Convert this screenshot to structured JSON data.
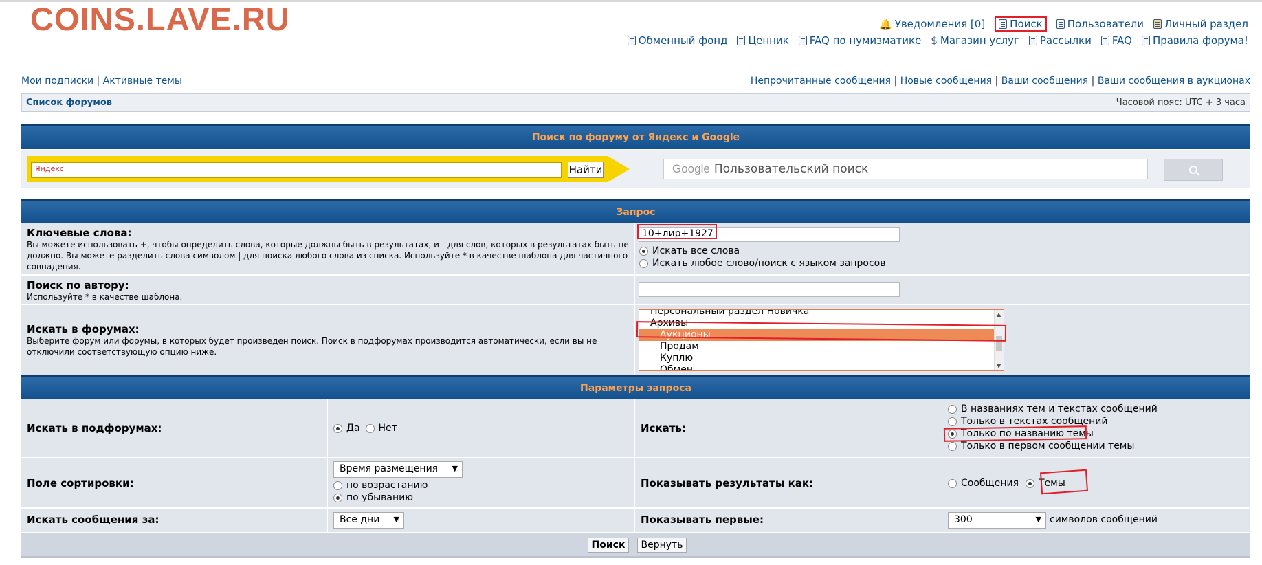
{
  "header": {
    "logo": "COINS.LAVE.RU",
    "nav_top": [
      {
        "label": "Уведомления [0]",
        "icon": "bell-icon"
      },
      {
        "label": "Поиск",
        "icon": "search-icon"
      },
      {
        "label": "Пользователи",
        "icon": "list-icon"
      },
      {
        "label": "Личный раздел",
        "icon": "user-icon"
      }
    ],
    "nav_bottom": [
      {
        "label": "Обменный фонд",
        "icon": "list-icon"
      },
      {
        "label": "Ценник",
        "icon": "list-icon"
      },
      {
        "label": "FAQ по нумизматике",
        "icon": "question-icon"
      },
      {
        "label": "Магазин услуг",
        "icon": "coins-icon"
      },
      {
        "label": "Рассылки",
        "icon": "newsletter-icon"
      },
      {
        "label": "FAQ",
        "icon": "question-icon"
      },
      {
        "label": "Правила форума!",
        "icon": "exclamation-icon"
      }
    ]
  },
  "subnav": {
    "left": [
      "Мои подписки",
      "Активные темы"
    ],
    "right": [
      "Непрочитанные сообщения",
      "Новые сообщения",
      "Ваши сообщения",
      "Ваши сообщения в аукционах"
    ]
  },
  "breadcrumb": {
    "label": "Список форумов",
    "timezone": "Часовой пояс: UTC + 3 часа"
  },
  "site_search": {
    "title": "Поиск по форуму от Яндекс и Google",
    "yandex_placeholder": "Яндекс",
    "yandex_button": "Найти",
    "google_placeholder": "Пользовательский поиск",
    "google_logo": "Google"
  },
  "query": {
    "title": "Запрос",
    "keywords_label": "Ключевые слова:",
    "keywords_hint": "Вы можете использовать +, чтобы определить слова, которые должны быть в результатах, и - для слов, которых в результатах быть не должно. Вы можете разделить слова символом | для поиска любого слова из списка. Используйте * в качестве шаблона для частичного совпадения.",
    "keywords_value": "10+лир+1927",
    "match_all": "Искать все слова",
    "match_any": "Искать любое слово/поиск с языком запросов",
    "author_label": "Поиск по автору:",
    "author_hint": "Используйте * в качестве шаблона.",
    "author_value": "",
    "forums_label": "Искать в форумах:",
    "forums_hint": "Выберите форум или форумы, в которых будет произведен поиск. Поиск в подфорумах производится автоматически, если вы не отключили соответствующую опцию ниже.",
    "forums_options": [
      {
        "label": "Персональный раздел Новичка",
        "sub": false,
        "selected": false
      },
      {
        "label": "Архивы",
        "sub": false,
        "selected": false
      },
      {
        "label": "Аукционы",
        "sub": true,
        "selected": true
      },
      {
        "label": "Продам",
        "sub": true,
        "selected": false
      },
      {
        "label": "Куплю",
        "sub": true,
        "selected": false
      },
      {
        "label": "Обмен",
        "sub": true,
        "selected": false
      }
    ]
  },
  "params": {
    "title": "Параметры запроса",
    "subforums_label": "Искать в подфорумах:",
    "subforums_yes": "Да",
    "subforums_no": "Нет",
    "search_in_label": "Искать:",
    "search_in_options": [
      "В названиях тем и текстах сообщений",
      "Только в текстах сообщений",
      "Только по названию темы",
      "Только в первом сообщении темы"
    ],
    "sort_label": "Поле сортировки:",
    "sort_value": "Время размещения",
    "sort_asc": "по возрастанию",
    "sort_desc": "по убыванию",
    "show_as_label": "Показывать результаты как:",
    "show_as_posts": "Сообщения",
    "show_as_topics": "Темы",
    "period_label": "Искать сообщения за:",
    "period_value": "Все дни",
    "first_label": "Показывать первые:",
    "first_value": "300",
    "first_suffix": "символов сообщений",
    "submit": "Поиск",
    "reset": "Вернуть"
  }
}
